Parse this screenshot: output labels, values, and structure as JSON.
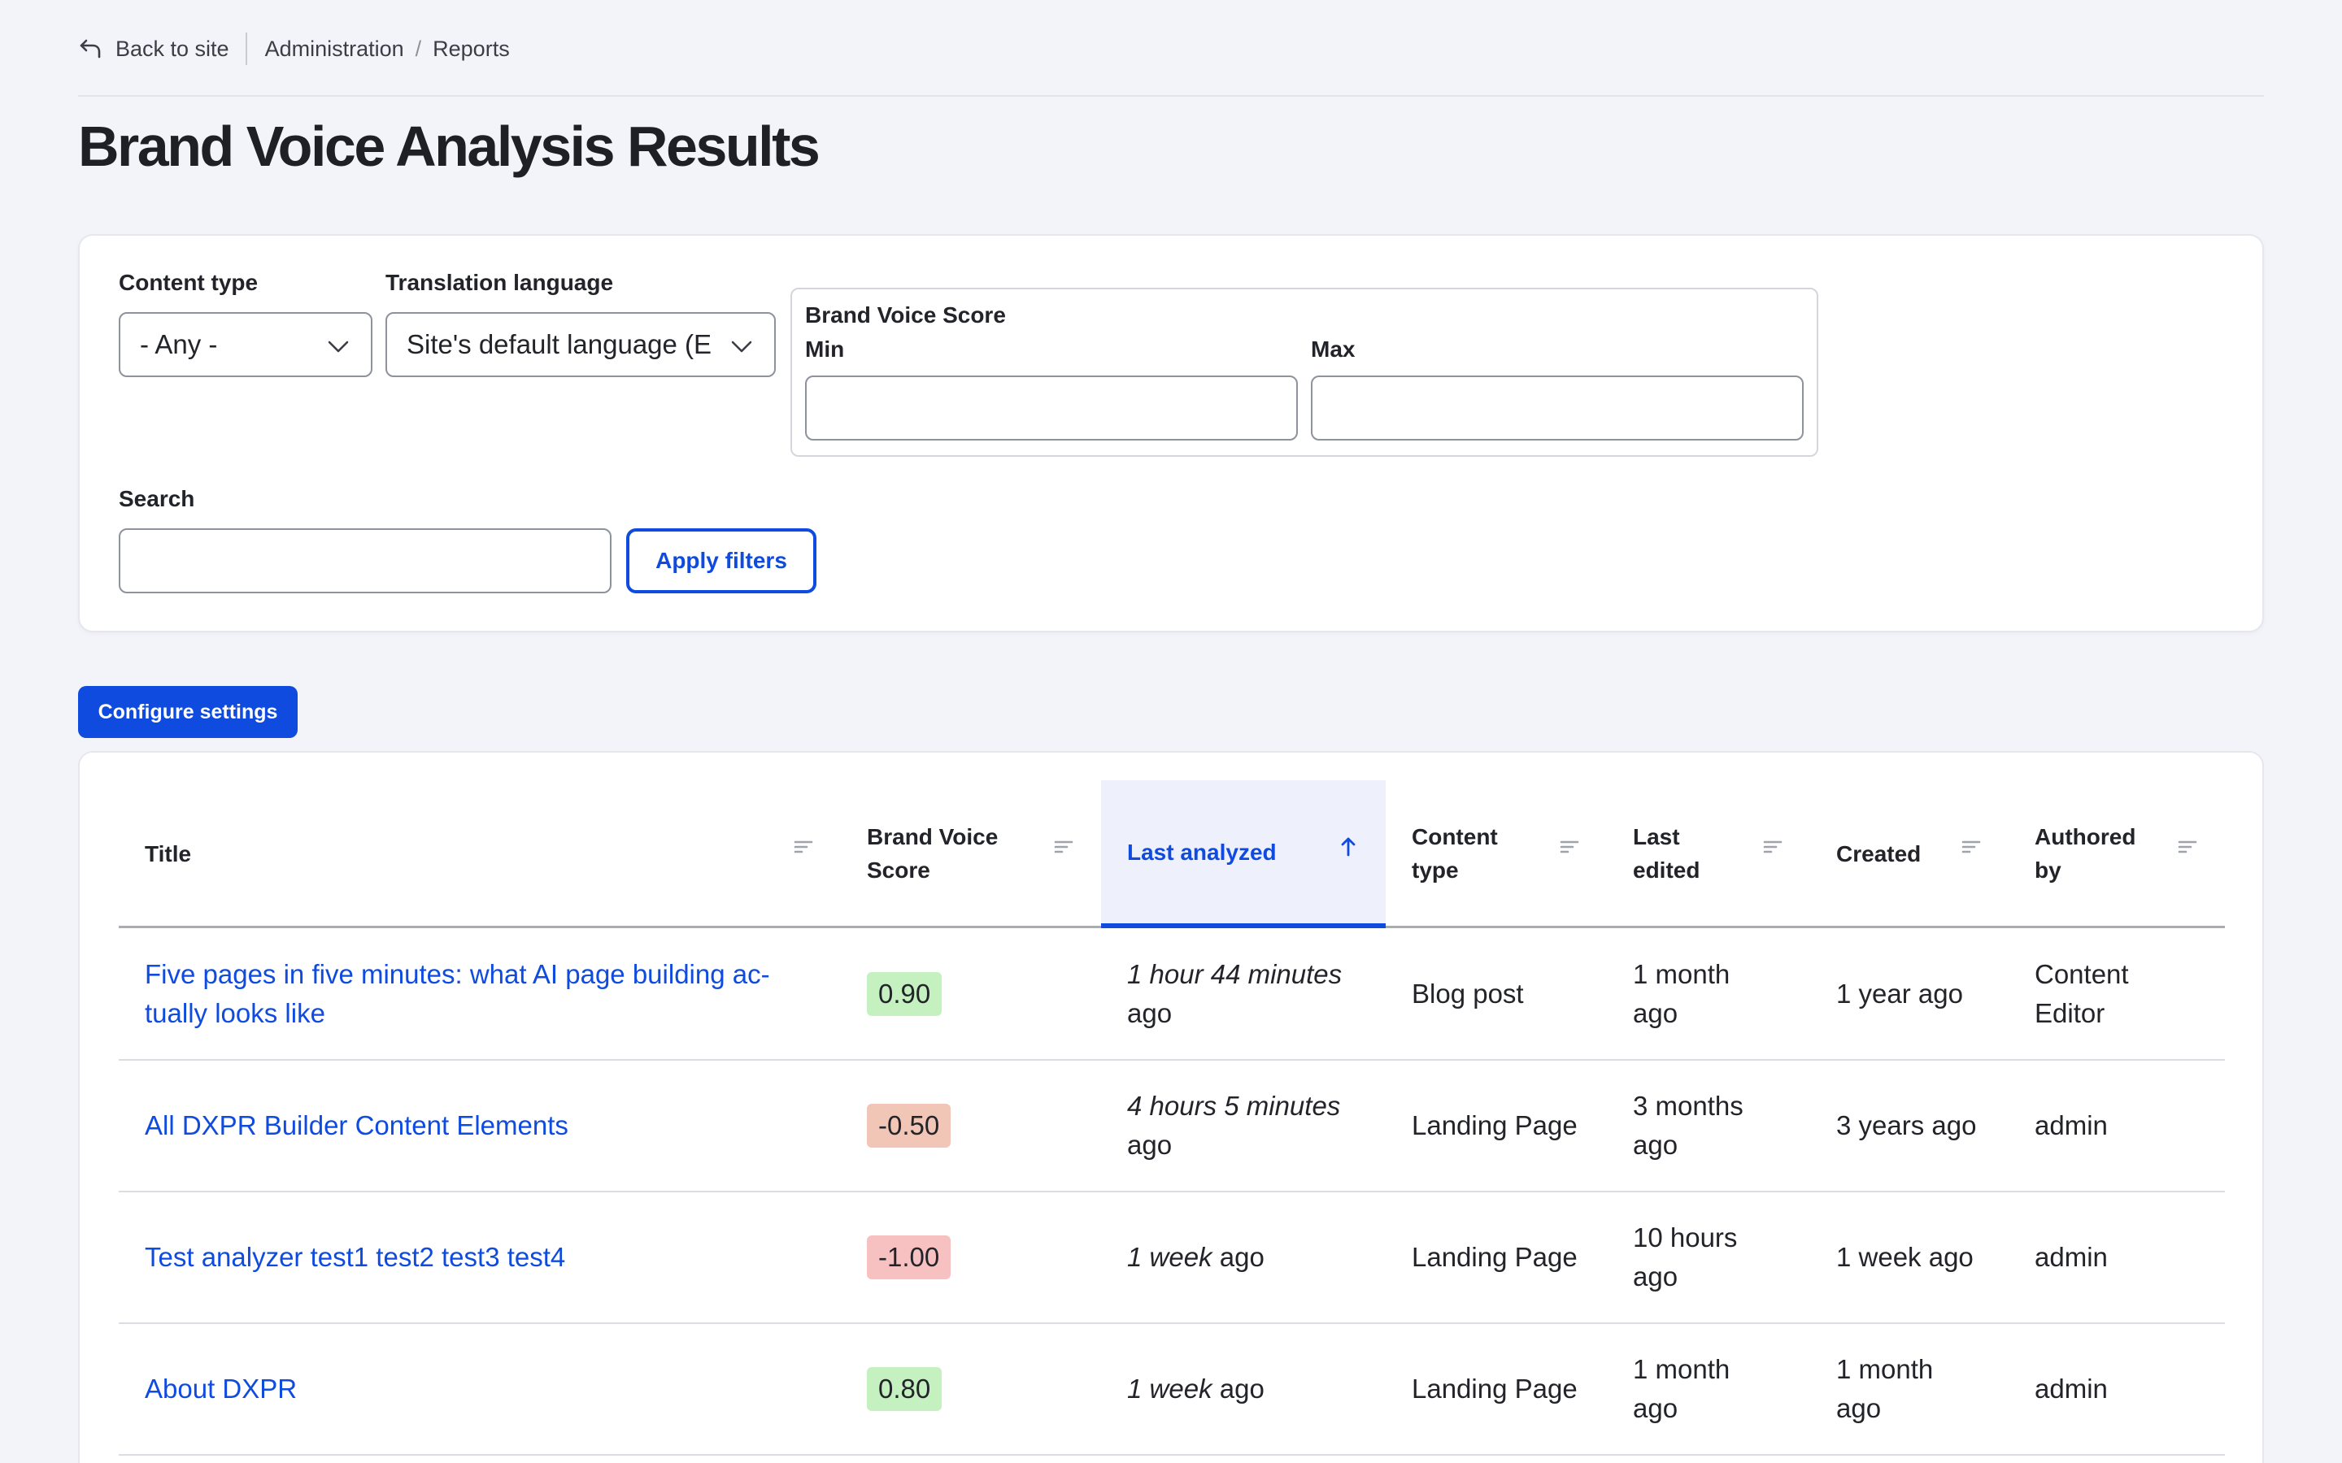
{
  "nav": {
    "back_label": "Back to site",
    "breadcrumb": [
      "Administration",
      "Reports"
    ],
    "separator": "/"
  },
  "page": {
    "title": "Brand Voice Analysis Results"
  },
  "filters": {
    "content_type": {
      "label": "Content type",
      "value": "- Any -"
    },
    "translation_language": {
      "label": "Translation language",
      "value": "Site's default language (E"
    },
    "score": {
      "legend": "Brand Voice Score",
      "min_label": "Min",
      "max_label": "Max",
      "min_value": "",
      "max_value": ""
    },
    "search": {
      "label": "Search",
      "value": ""
    },
    "apply_label": "Apply filters"
  },
  "actions": {
    "configure_label": "Configure settings"
  },
  "table": {
    "columns": [
      "Title",
      "Brand Voice Score",
      "Last analyzed",
      "Content type",
      "Last edited",
      "Created",
      "Authored by"
    ],
    "sorted_column": "Last analyzed",
    "rows": [
      {
        "title": "Five pages in five minutes: what AI page building ac-tually looks like",
        "score": "0.90",
        "score_color": "#c5f0c0",
        "analyzed_em": "1 hour 44 minutes",
        "analyzed_suffix": "ago",
        "type": "Blog post",
        "edited": "1 month ago",
        "created": "1 year ago",
        "author": "Content Editor"
      },
      {
        "title": "All DXPR Builder Content Elements",
        "score": "-0.50",
        "score_color": "#f2c6b6",
        "analyzed_em": "4 hours 5 minutes",
        "analyzed_suffix": "ago",
        "type": "Landing Page",
        "edited": "3 months ago",
        "created": "3 years ago",
        "author": "admin"
      },
      {
        "title": "Test analyzer test1 test2 test3 test4",
        "score": "-1.00",
        "score_color": "#f8c1c1",
        "analyzed_em": "1 week",
        "analyzed_suffix": "ago",
        "type": "Landing Page",
        "edited": "10 hours ago",
        "created": "1 week ago",
        "author": "admin"
      },
      {
        "title": "About DXPR",
        "score": "0.80",
        "score_color": "#c5f0c0",
        "analyzed_em": "1 week",
        "analyzed_suffix": "ago",
        "type": "Landing Page",
        "edited": "1 month ago",
        "created": "1 month ago",
        "author": "admin"
      }
    ]
  },
  "colors": {
    "accent": "#0f4bde",
    "background": "#f3f4f9"
  }
}
